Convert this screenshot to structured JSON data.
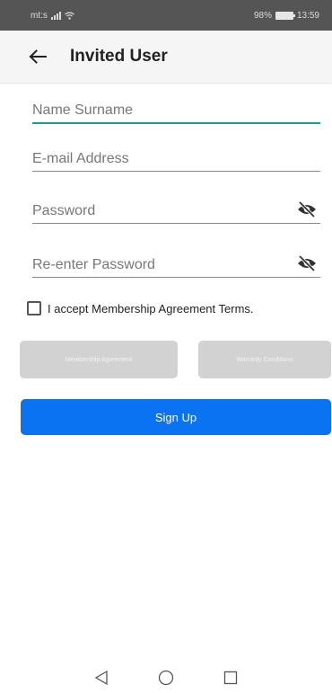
{
  "status_bar": {
    "carrier": "mt:s",
    "battery_percent": "98%",
    "time": "13:59"
  },
  "app_bar": {
    "title": "Invited User"
  },
  "form": {
    "name": {
      "placeholder": "Name Surname",
      "value": ""
    },
    "email": {
      "placeholder": "E-mail Address",
      "value": ""
    },
    "password": {
      "placeholder": "Password",
      "value": ""
    },
    "reenter_password": {
      "placeholder": "Re-enter Password",
      "value": ""
    }
  },
  "terms": {
    "label": "I accept Membership Agreement Terms.",
    "checked": false
  },
  "buttons": {
    "membership_agreement": "Membership Agreement",
    "warranty_conditions": "Warranty Conditions",
    "sign_up": "Sign Up"
  },
  "colors": {
    "primary": "#0a73f2",
    "accent_underline": "#1c9c8c",
    "disabled_button": "#d2d2d2",
    "status_bar": "#555555"
  },
  "icons": {
    "back": "arrow-left-icon",
    "password_visibility": "eye-off-icon",
    "nav_back": "triangle-back-icon",
    "nav_home": "circle-home-icon",
    "nav_recents": "square-recents-icon"
  }
}
